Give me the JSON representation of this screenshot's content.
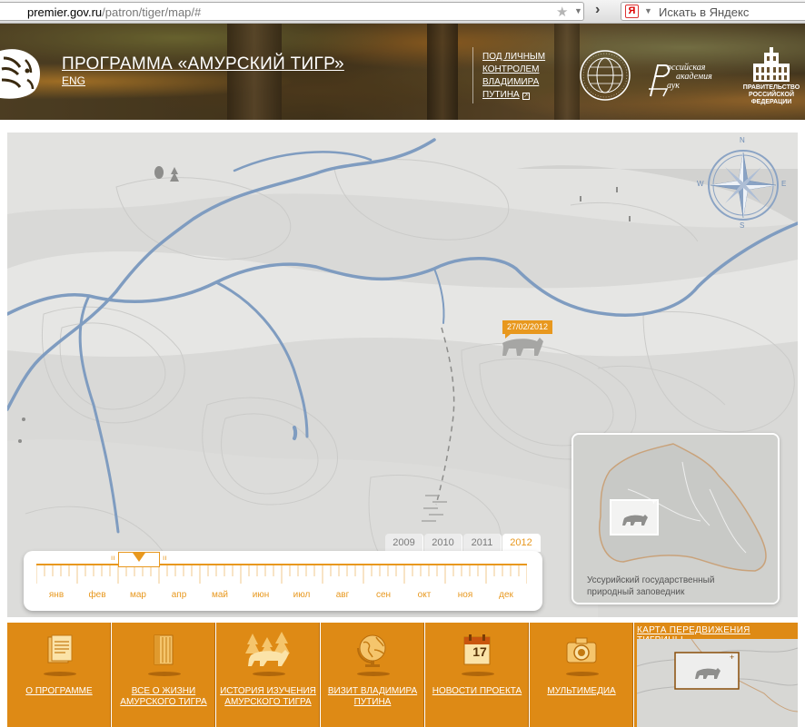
{
  "browser": {
    "url_host": "premier.gov.ru",
    "url_path": "/patron/tiger/map/#",
    "search_icon_letter": "Я",
    "search_placeholder": "Искать в Яндекс"
  },
  "header": {
    "title": "ПРОГРАММА «АМУРСКИЙ ТИГР»",
    "lang_link": "ENG",
    "control_lines": [
      "ПОД ЛИЧНЫМ",
      "КОНТРОЛЕМ",
      "ВЛАДИМИРА",
      "ПУТИНА"
    ],
    "ran_lines": [
      "оссийская",
      "академия",
      "аук"
    ],
    "gov_lines": [
      "ПРАВИТЕЛЬСТВО",
      "РОССИЙСКОЙ",
      "ФЕДЕРАЦИИ"
    ]
  },
  "map": {
    "compass": {
      "n": "N",
      "s": "S",
      "e": "E",
      "w": "W"
    },
    "marker_date": "27/02/2012",
    "colors": {
      "river": "#7f9cc0",
      "land": "#d9d9d7",
      "accent": "#e8981e",
      "nav": "#de8a15"
    }
  },
  "timeline": {
    "years": [
      "2009",
      "2010",
      "2011",
      "2012"
    ],
    "active_year": "2012",
    "months": [
      "янв",
      "фев",
      "мар",
      "апр",
      "май",
      "июн",
      "июл",
      "авг",
      "сен",
      "окт",
      "ноя",
      "дек"
    ],
    "selected_month": "мар"
  },
  "inset": {
    "caption_line1": "Уссурийский государственный",
    "caption_line2": "природный заповедник"
  },
  "nav": {
    "items": [
      {
        "label": "О ПРОГРАММЕ",
        "icon": "document-icon"
      },
      {
        "label": "ВСЕ О ЖИЗНИ АМУРСКОГО ТИГРА",
        "icon": "book-icon"
      },
      {
        "label": "ИСТОРИЯ ИЗУЧЕНИЯ АМУРСКОГО ТИГРА",
        "icon": "forest-tiger-icon"
      },
      {
        "label": "ВИЗИТ ВЛАДИМИРА ПУТИНА",
        "icon": "globe-icon"
      },
      {
        "label": "НОВОСТИ ПРОЕКТА",
        "icon": "calendar-icon"
      },
      {
        "label": "МУЛЬТИМЕДИА",
        "icon": "camera-icon"
      }
    ],
    "calendar_day": "17",
    "map_title": "КАРТА ПЕРЕДВИЖЕНИЯ ТИГРИЦЫ"
  }
}
